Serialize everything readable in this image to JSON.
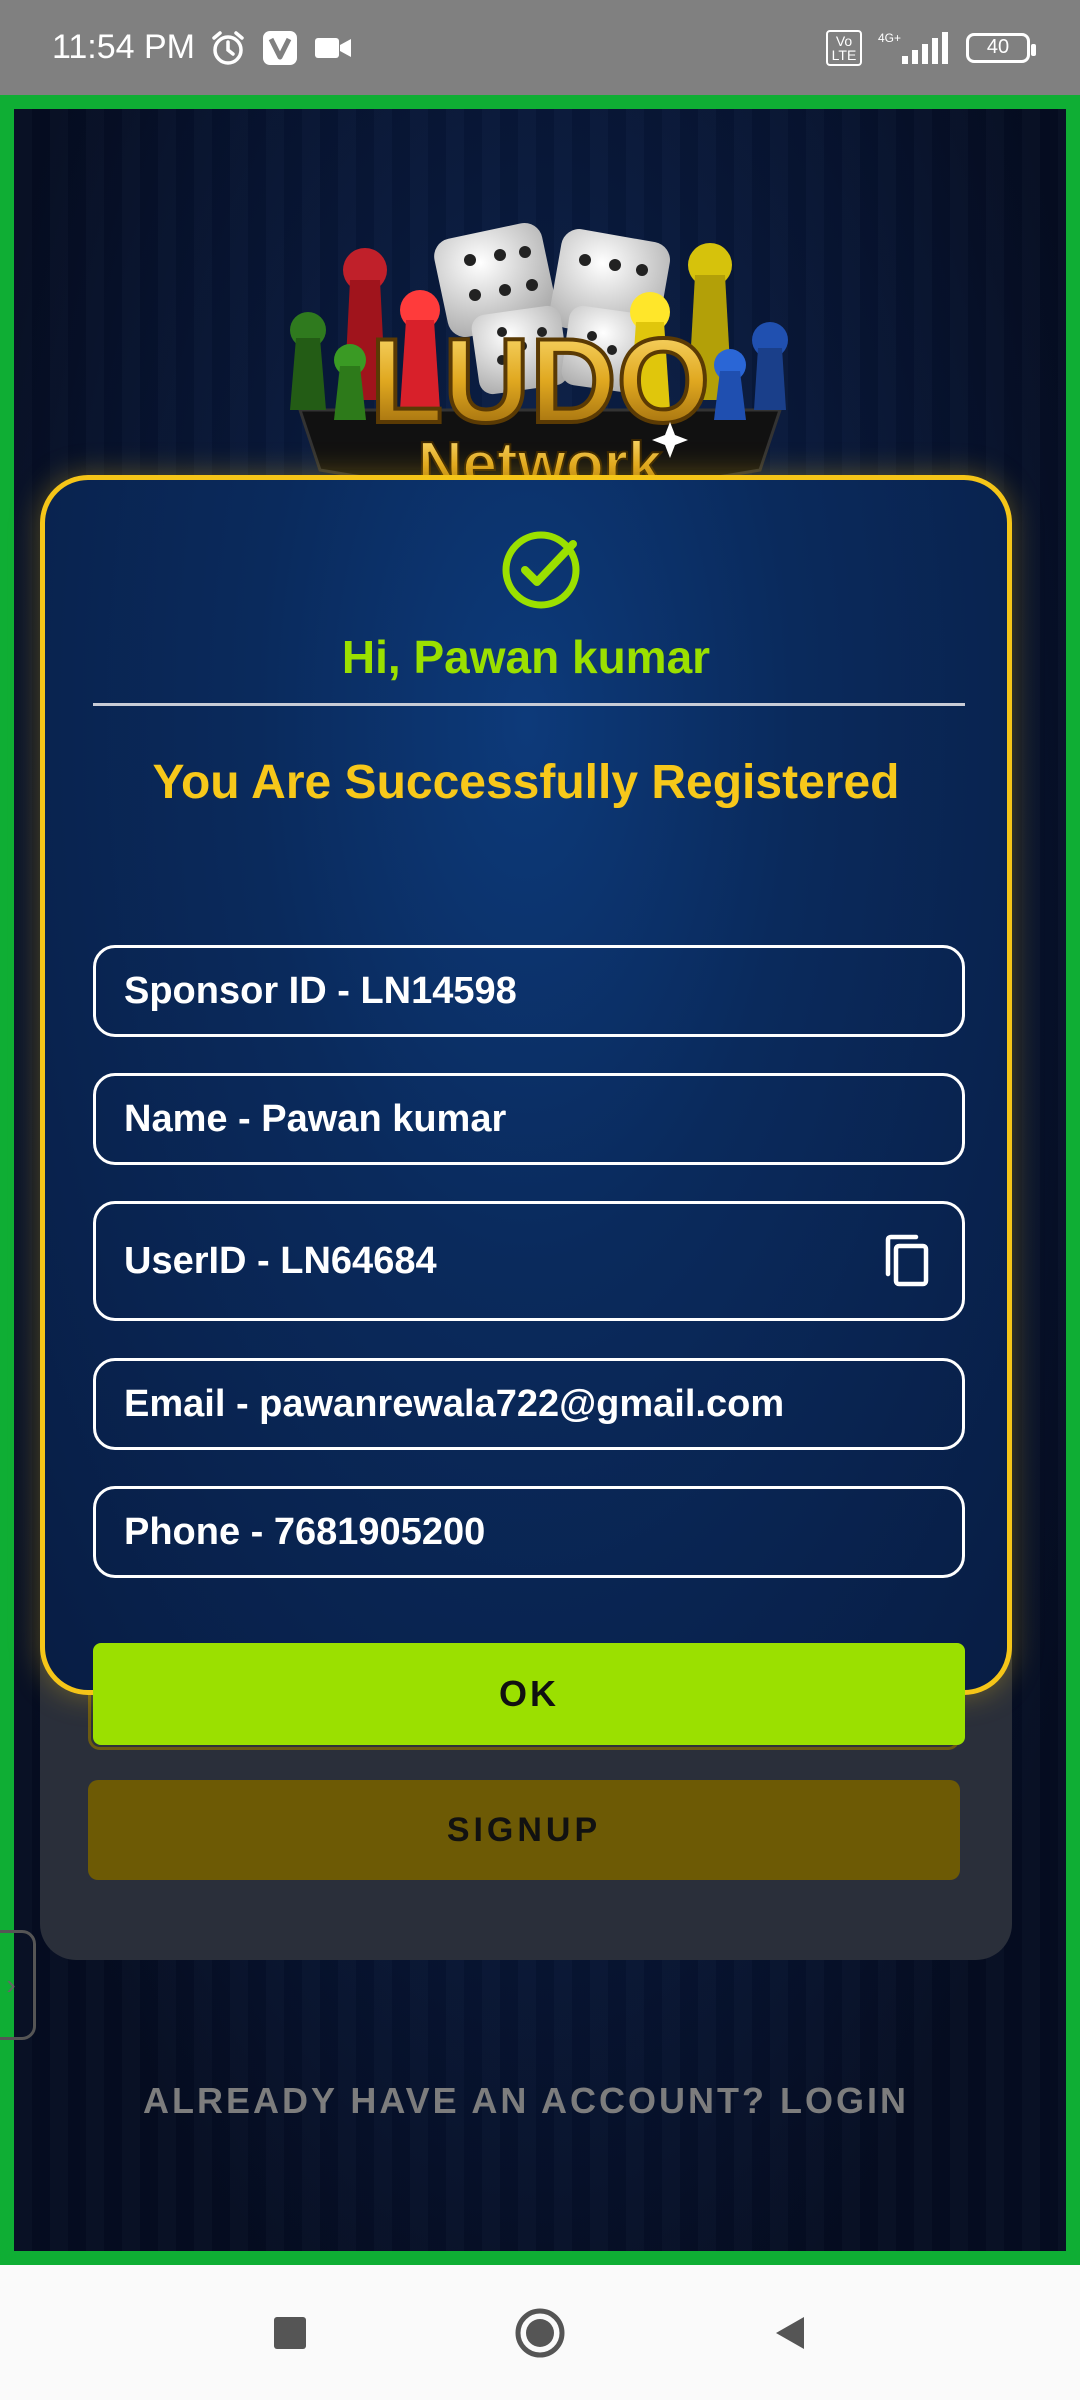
{
  "status_bar": {
    "time": "11:54 PM",
    "volte": "Vo LTE",
    "network": "4G+",
    "battery": "40",
    "icons": [
      "alarm-icon",
      "v-app-icon",
      "video-camera-icon",
      "signal-icon",
      "battery-icon"
    ]
  },
  "logo": {
    "word1": "LUDO",
    "word2": "Network"
  },
  "dialog": {
    "greeting": "Hi, Pawan kumar",
    "success_message": "You Are Successfully Registered",
    "fields": {
      "sponsor_id": "Sponsor ID - LN14598",
      "name": "Name - Pawan kumar",
      "user_id": "UserID - LN64684",
      "email": "Email - pawanrewala722@gmail.com",
      "phone": "Phone - 7681905200"
    },
    "ok_label": "OK"
  },
  "background_form": {
    "signup_label": "SIGNUP",
    "login_link": "ALREADY HAVE AN ACCOUNT? LOGIN",
    "side_tab_glyph": "›"
  },
  "colors": {
    "accent_green": "#9be000",
    "accent_gold": "#f5c518",
    "frame_green": "#0fae34",
    "dialog_blue": "#0a2a5c"
  }
}
